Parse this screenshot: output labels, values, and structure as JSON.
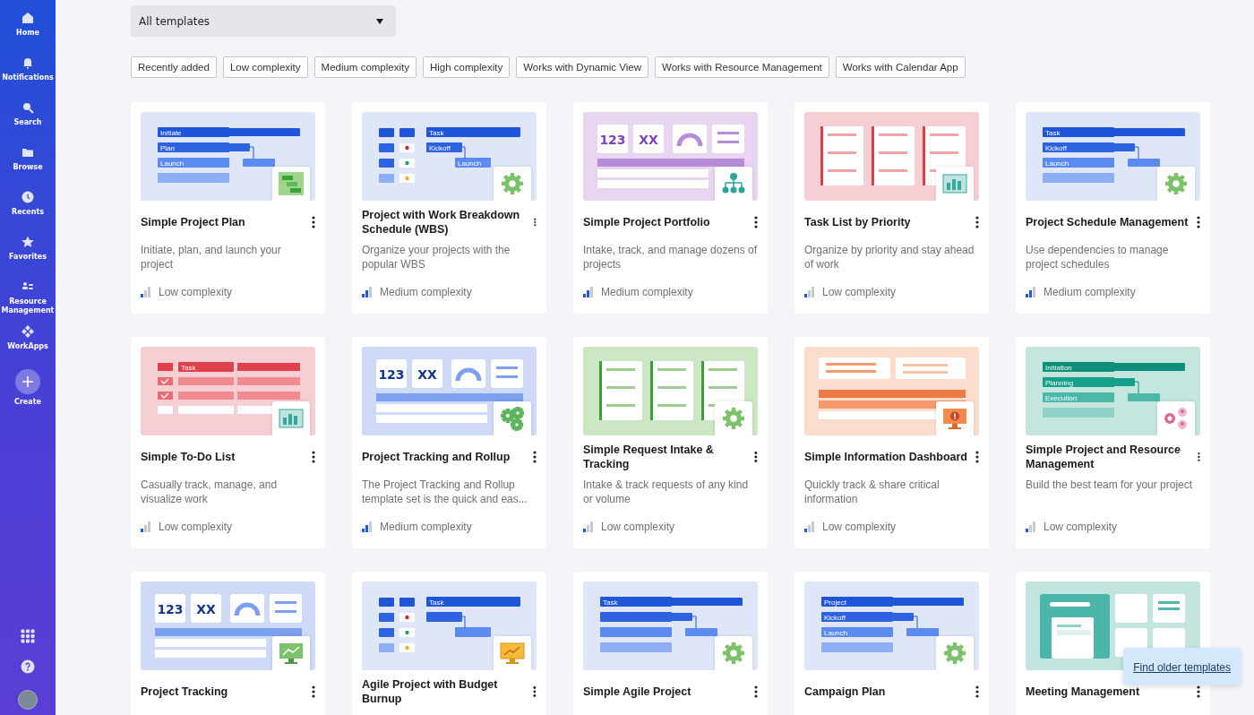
{
  "sidebar": {
    "items": [
      {
        "label": "Home",
        "kind": "home"
      },
      {
        "label": "Notifications",
        "kind": "bell"
      },
      {
        "label": "Search",
        "kind": "search"
      },
      {
        "label": "Browse",
        "kind": "folder"
      },
      {
        "label": "Recents",
        "kind": "clock"
      },
      {
        "label": "Favorites",
        "kind": "star"
      },
      {
        "label": "Resource Management",
        "kind": "people"
      },
      {
        "label": "WorkApps",
        "kind": "apps"
      },
      {
        "label": "Create",
        "kind": "create"
      }
    ],
    "bottom": [
      {
        "kind": "grid"
      },
      {
        "kind": "help"
      },
      {
        "kind": "avatar"
      }
    ]
  },
  "filter": {
    "value": "All templates"
  },
  "chips": [
    "Recently added",
    "Low complexity",
    "Medium complexity",
    "High complexity",
    "Works with Dynamic View",
    "Works with Resource Management",
    "Works with Calendar App"
  ],
  "cards": [
    {
      "title": "Simple Project Plan",
      "description": "Initiate, plan, and launch your project",
      "complexity": {
        "label": "Low complexity",
        "level": 0.33
      },
      "thumb": {
        "kind": "gantt",
        "color": "#dfe6f7",
        "labels": [
          "Initiate",
          "Plan",
          "Launch"
        ]
      },
      "badge": {
        "kind": "gantt"
      }
    },
    {
      "title": "Project with Work Breakdown Schedule (WBS)",
      "description": "Organize your projects with the popular WBS",
      "complexity": {
        "label": "Medium complexity",
        "level": 0.67
      },
      "thumb": {
        "kind": "wbs",
        "color": "#dfe6f7",
        "labels": [
          "Task",
          "Kickoff",
          "Launch"
        ]
      },
      "badge": {
        "kind": "gear"
      }
    },
    {
      "title": "Simple Project Portfolio",
      "description": "Intake, track, and manage dozens of projects",
      "complexity": {
        "label": "Medium complexity",
        "level": 0.67
      },
      "thumb": {
        "kind": "tiles",
        "color": "#e8d6f1",
        "labels": [
          "123",
          "XX"
        ]
      },
      "badge": {
        "kind": "org"
      }
    },
    {
      "title": "Task List by Priority",
      "description": "Organize by priority and stay ahead of work",
      "complexity": {
        "label": "Low complexity",
        "level": 0.33
      },
      "thumb": {
        "kind": "lists",
        "color": "#f6cfd4"
      },
      "badge": {
        "kind": "grid"
      }
    },
    {
      "title": "Project Schedule Management",
      "description": "Use dependencies to manage project schedules",
      "complexity": {
        "label": "Medium complexity",
        "level": 0.67
      },
      "thumb": {
        "kind": "gantt",
        "color": "#dfe6f7",
        "labels": [
          "Task",
          "Kickoff",
          "Launch"
        ]
      },
      "badge": {
        "kind": "gear"
      }
    },
    {
      "title": "Simple To-Do List",
      "description": "Casually track, manage, and visualize work",
      "complexity": {
        "label": "Low complexity",
        "level": 0.33
      },
      "thumb": {
        "kind": "todo",
        "color": "#f6cfd4",
        "labels": [
          "Task"
        ]
      },
      "badge": {
        "kind": "grid"
      }
    },
    {
      "title": "Project Tracking and Rollup",
      "description": "The Project Tracking and Rollup template set is the quick and eas...",
      "complexity": {
        "label": "Medium complexity",
        "level": 0.67
      },
      "thumb": {
        "kind": "tiles",
        "color": "#cfdaf8",
        "labels": [
          "123",
          "XX"
        ]
      },
      "badge": {
        "kind": "gears"
      }
    },
    {
      "title": "Simple Request Intake & Tracking",
      "description": "Intake & track requests of any kind or volume",
      "complexity": {
        "label": "Low complexity",
        "level": 0.33
      },
      "thumb": {
        "kind": "lists",
        "color": "#cde6c4"
      },
      "badge": {
        "kind": "gear"
      }
    },
    {
      "title": "Simple Information Dashboard",
      "description": "Quickly track & share critical information",
      "complexity": {
        "label": "Low complexity",
        "level": 0.33
      },
      "thumb": {
        "kind": "table",
        "color": "#fcdccd"
      },
      "badge": {
        "kind": "alert"
      }
    },
    {
      "title": "Simple Project and Resource Management",
      "description": "Build the best team for your project",
      "complexity": {
        "label": "Low complexity",
        "level": 0.33
      },
      "thumb": {
        "kind": "gantt",
        "color": "#c4e6de",
        "labels": [
          "Initiation",
          "Planning",
          "Execution"
        ]
      },
      "badge": {
        "kind": "people"
      }
    },
    {
      "title": "Project Tracking",
      "thumb": {
        "kind": "tiles",
        "color": "#cfdaf8",
        "labels": [
          "123",
          "XX"
        ]
      },
      "badge": {
        "kind": "monitor"
      }
    },
    {
      "title": "Agile Project with Budget Burnup",
      "thumb": {
        "kind": "wbs",
        "color": "#dfe6f7",
        "labels": [
          "Task"
        ]
      },
      "badge": {
        "kind": "chart"
      }
    },
    {
      "title": "Simple Agile Project",
      "thumb": {
        "kind": "gantt",
        "color": "#dfe6f7",
        "labels": [
          "Task"
        ]
      },
      "badge": {
        "kind": "gear"
      }
    },
    {
      "title": "Campaign Plan",
      "thumb": {
        "kind": "gantt",
        "color": "#dfe6f7",
        "labels": [
          "Project",
          "Kickoff",
          "Launch"
        ]
      },
      "badge": {
        "kind": "gear"
      }
    },
    {
      "title": "Meeting Management",
      "thumb": {
        "kind": "meeting",
        "color": "#c2e5df"
      }
    }
  ],
  "popup": {
    "link": "Find older templates"
  }
}
